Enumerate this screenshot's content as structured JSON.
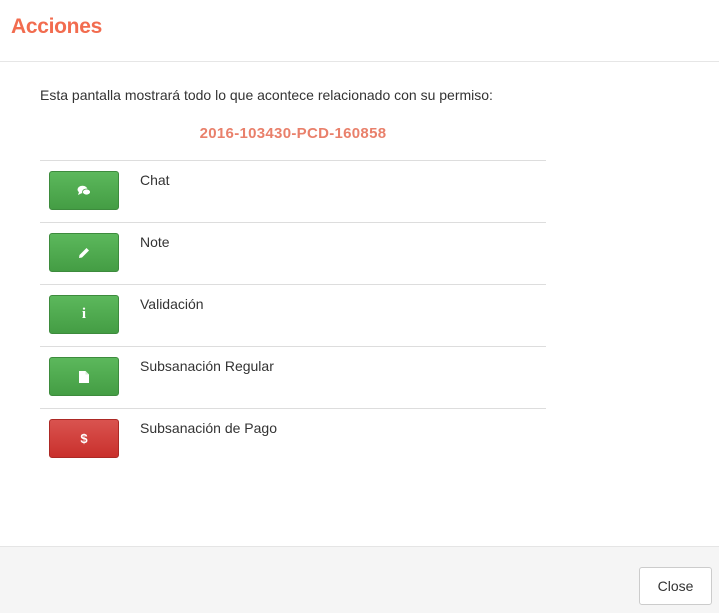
{
  "header": {
    "title": "Acciones"
  },
  "body": {
    "intro": "Esta pantalla mostrará todo lo que acontece relacionado con su permiso:",
    "permit_number": "2016-103430-PCD-160858"
  },
  "actions": [
    {
      "label": "Chat",
      "icon": "chat-bubbles-icon",
      "color": "#5cb85c"
    },
    {
      "label": "Note",
      "icon": "pencil-icon",
      "color": "#5cb85c"
    },
    {
      "label": "Validación",
      "icon": "info-icon",
      "color": "#5cb85c"
    },
    {
      "label": "Subsanación Regular",
      "icon": "file-icon",
      "color": "#5cb85c"
    },
    {
      "label": "Subsanación de Pago",
      "icon": "dollar-icon",
      "color": "#d9534f"
    }
  ],
  "footer": {
    "close_label": "Close"
  },
  "colors": {
    "accent": "#f26c4f",
    "permit": "#e9806b",
    "success": "#5cb85c",
    "danger": "#d9534f"
  }
}
